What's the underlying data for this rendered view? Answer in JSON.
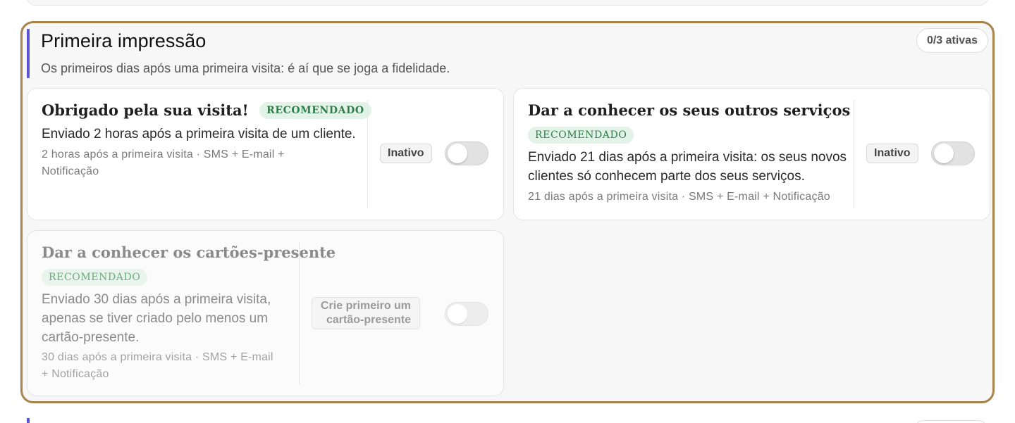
{
  "section": {
    "title": "Primeira impressão",
    "subtitle": "Os primeiros dias após uma primeira visita: é aí que se joga a fidelidade.",
    "active_count": "0/3 ativas",
    "accent_color": "#5b55d6",
    "highlight_border_color": "#a8824a"
  },
  "cards": [
    {
      "title": "Obrigado pela sua visita!",
      "badge": "RECOMENDADO",
      "description": "Enviado 2 horas após a primeira visita de um cliente.",
      "meta_line1": "2 horas após a primeira visita · SMS + E-mail +",
      "meta_line2": "Notificação",
      "status": "Inativo",
      "enabled": false
    },
    {
      "title": "Dar a conhecer os seus outros serviços",
      "badge": "RECOMENDADO",
      "description_line1": "Enviado 21 dias após a primeira visita: os seus novos",
      "description_line2": "clientes só conhecem parte dos seus serviços.",
      "meta": "21 dias após a primeira visita · SMS + E-mail + Notificação",
      "status": "Inativo",
      "enabled": false
    },
    {
      "title": "Dar a conhecer os cartões-presente",
      "badge": "RECOMENDADO",
      "description_line1": "Enviado 30 dias após a primeira visita,",
      "description_line2": "apenas se tiver criado pelo menos um",
      "description_line3": "cartão-presente.",
      "meta_line1": "30 dias após a primeira visita · SMS + E-mail",
      "meta_line2": "+ Notificação",
      "status_line1": "Crie primeiro um",
      "status_line2": "cartão-presente",
      "enabled": false,
      "disabled": true
    }
  ],
  "colors": {
    "badge_bg": "#e3f3e7",
    "badge_text": "#2f7d4a"
  }
}
